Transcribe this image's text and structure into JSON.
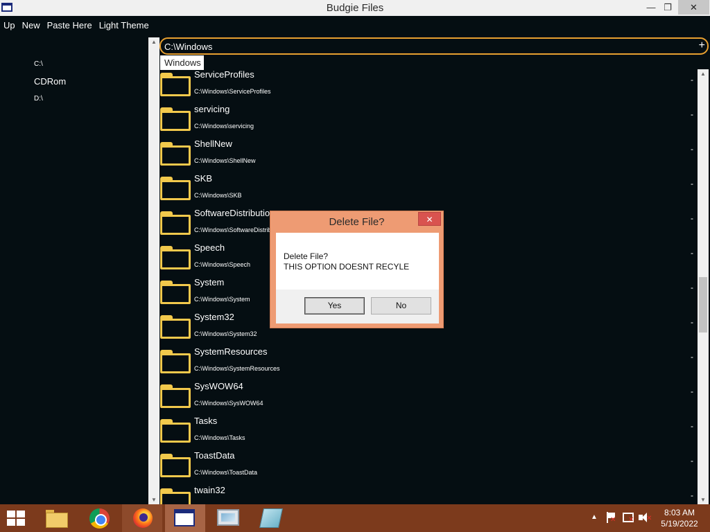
{
  "window": {
    "title": "Budgie Files",
    "min_glyph": "—",
    "max_glyph": "❐",
    "close_glyph": "✕"
  },
  "menu": [
    "Up",
    "New",
    "Paste Here",
    "Light Theme"
  ],
  "sidebar": {
    "drives": [
      "C:\\",
      "CDRom",
      "D:\\"
    ]
  },
  "path_bar": {
    "value": "C:\\Windows",
    "add_glyph": "+"
  },
  "breadcrumb": "Windows",
  "files": [
    {
      "name": "ServiceProfiles",
      "path": "C:\\Windows\\ServiceProfiles"
    },
    {
      "name": "servicing",
      "path": "C:\\Windows\\servicing"
    },
    {
      "name": "ShellNew",
      "path": "C:\\Windows\\ShellNew"
    },
    {
      "name": "SKB",
      "path": "C:\\Windows\\SKB"
    },
    {
      "name": "SoftwareDistribution",
      "path": "C:\\Windows\\SoftwareDistrib"
    },
    {
      "name": "Speech",
      "path": "C:\\Windows\\Speech"
    },
    {
      "name": "System",
      "path": "C:\\Windows\\System"
    },
    {
      "name": "System32",
      "path": "C:\\Windows\\System32"
    },
    {
      "name": "SystemResources",
      "path": "C:\\Windows\\SystemResources"
    },
    {
      "name": "SysWOW64",
      "path": "C:\\Windows\\SysWOW64"
    },
    {
      "name": "Tasks",
      "path": "C:\\Windows\\Tasks"
    },
    {
      "name": "ToastData",
      "path": "C:\\Windows\\ToastData"
    },
    {
      "name": "twain32",
      "path": ""
    }
  ],
  "row_action_glyph": "-",
  "scroll_position": 0.55,
  "dialog": {
    "title": "Delete File?",
    "close_glyph": "✕",
    "message_line1": "Delete File?",
    "message_line2": "THIS OPTION DOESNT RECYLE",
    "yes_label": "Yes",
    "no_label": "No"
  },
  "taskbar": {
    "icons": [
      "windows-start-icon",
      "file-explorer-icon",
      "chrome-icon",
      "firefox-icon",
      "budgie-files-icon",
      "monitor-icon",
      "notepad-icon"
    ],
    "tray_up_glyph": "▲",
    "time": "8:03 AM",
    "date": "5/19/2022"
  },
  "colors": {
    "background": "#050e12",
    "folder": "#f2c94c",
    "path_border": "#e8a030",
    "dialog_frame": "#ee9b73",
    "taskbar": "#7c3a1c"
  }
}
